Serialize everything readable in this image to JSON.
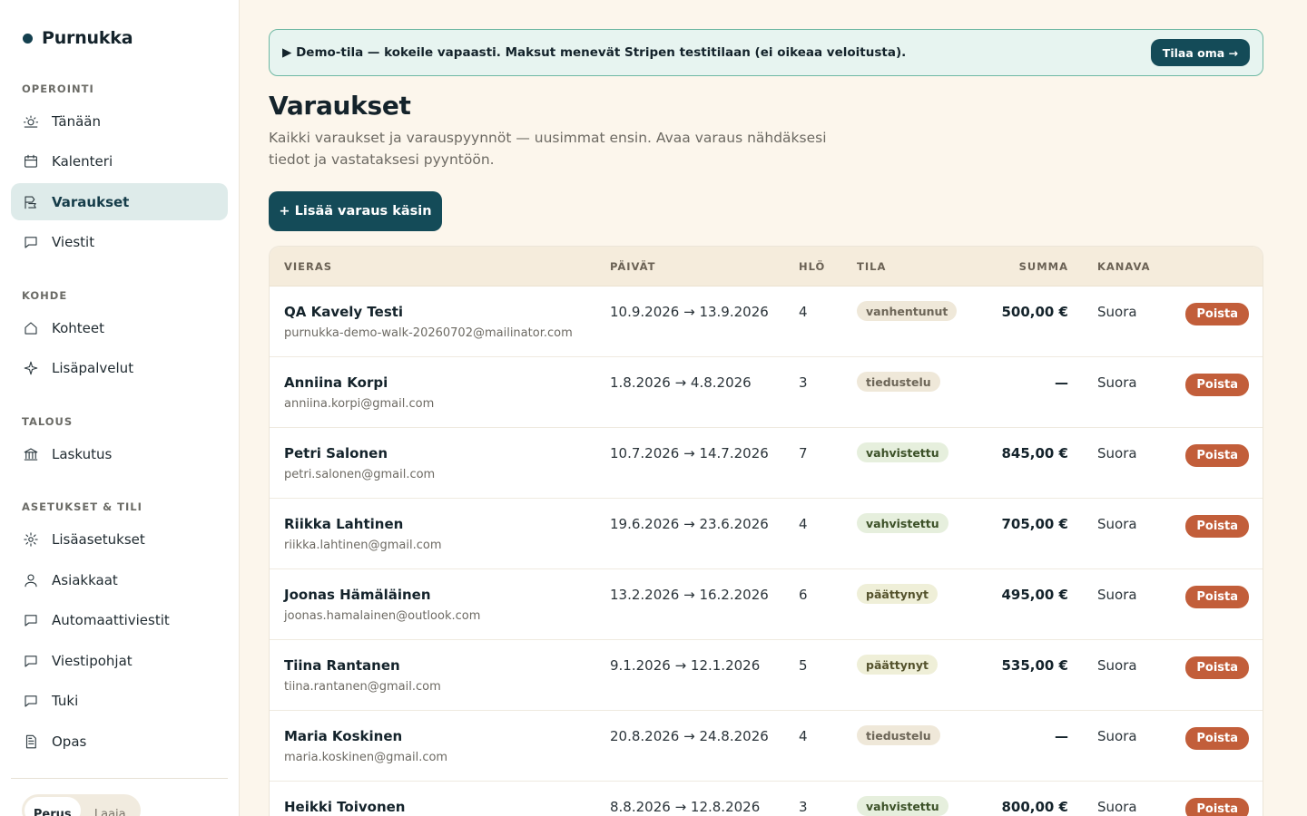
{
  "brand": {
    "name": "Purnukka"
  },
  "sidebar": {
    "sections": [
      {
        "label": "OPEROINTI",
        "items": [
          {
            "label": "Tänään",
            "icon": "sun-icon"
          },
          {
            "label": "Kalenteri",
            "icon": "calendar-icon"
          },
          {
            "label": "Varaukset",
            "icon": "bookings-icon",
            "active": true
          },
          {
            "label": "Viestit",
            "icon": "chat-icon"
          }
        ]
      },
      {
        "label": "KOHDE",
        "items": [
          {
            "label": "Kohteet",
            "icon": "home-icon"
          },
          {
            "label": "Lisäpalvelut",
            "icon": "sparkle-icon"
          }
        ]
      },
      {
        "label": "TALOUS",
        "items": [
          {
            "label": "Laskutus",
            "icon": "bank-icon"
          }
        ]
      },
      {
        "label": "ASETUKSET & TILI",
        "items": [
          {
            "label": "Lisäasetukset",
            "icon": "gear-icon"
          },
          {
            "label": "Asiakkaat",
            "icon": "user-icon"
          },
          {
            "label": "Automaattiviestit",
            "icon": "chat-icon"
          },
          {
            "label": "Viestipohjat",
            "icon": "chat-icon"
          },
          {
            "label": "Tuki",
            "icon": "chat-icon"
          },
          {
            "label": "Opas",
            "icon": "document-icon"
          }
        ]
      }
    ],
    "mode_toggle": {
      "options": [
        "Perus",
        "Laaja"
      ],
      "selected": "Perus"
    }
  },
  "banner": {
    "text": "▶ Demo-tila — kokeile vapaasti. Maksut menevät Stripen testitilaan (ei oikeaa veloitusta).",
    "button": "Tilaa oma →"
  },
  "page": {
    "title": "Varaukset",
    "subtitle": "Kaikki varaukset ja varauspyynnöt — uusimmat ensin. Avaa varaus nähdäksesi tiedot ja vastataksesi pyyntöön.",
    "add_button": "+ Lisää varaus käsin"
  },
  "table": {
    "headers": {
      "guest": "VIERAS",
      "dates": "PÄIVÄT",
      "people": "HLÖ",
      "status": "TILA",
      "sum": "SUMMA",
      "channel": "KANAVA"
    },
    "delete_label": "Poista",
    "rows": [
      {
        "name": "QA Kavely Testi",
        "email": "purnukka-demo-walk-20260702@mailinator.com",
        "dates": "10.9.2026 → 13.9.2026",
        "people": "4",
        "status": "vanhentunut",
        "status_class": "vanhentunut",
        "sum": "500,00 €",
        "channel": "Suora"
      },
      {
        "name": "Anniina Korpi",
        "email": "anniina.korpi@gmail.com",
        "dates": "1.8.2026 → 4.8.2026",
        "people": "3",
        "status": "tiedustelu",
        "status_class": "tiedustelu",
        "sum": "—",
        "channel": "Suora"
      },
      {
        "name": "Petri Salonen",
        "email": "petri.salonen@gmail.com",
        "dates": "10.7.2026 → 14.7.2026",
        "people": "7",
        "status": "vahvistettu",
        "status_class": "vahvistettu",
        "sum": "845,00 €",
        "channel": "Suora"
      },
      {
        "name": "Riikka Lahtinen",
        "email": "riikka.lahtinen@gmail.com",
        "dates": "19.6.2026 → 23.6.2026",
        "people": "4",
        "status": "vahvistettu",
        "status_class": "vahvistettu",
        "sum": "705,00 €",
        "channel": "Suora"
      },
      {
        "name": "Joonas Hämäläinen",
        "email": "joonas.hamalainen@outlook.com",
        "dates": "13.2.2026 → 16.2.2026",
        "people": "6",
        "status": "päättynyt",
        "status_class": "paattynyt",
        "sum": "495,00 €",
        "channel": "Suora"
      },
      {
        "name": "Tiina Rantanen",
        "email": "tiina.rantanen@gmail.com",
        "dates": "9.1.2026 → 12.1.2026",
        "people": "5",
        "status": "päättynyt",
        "status_class": "paattynyt",
        "sum": "535,00 €",
        "channel": "Suora"
      },
      {
        "name": "Maria Koskinen",
        "email": "maria.koskinen@gmail.com",
        "dates": "20.8.2026 → 24.8.2026",
        "people": "4",
        "status": "tiedustelu",
        "status_class": "tiedustelu",
        "sum": "—",
        "channel": "Suora"
      },
      {
        "name": "Heikki Toivonen",
        "email": "",
        "dates": "8.8.2026 → 12.8.2026",
        "people": "3",
        "status": "vahvistettu",
        "status_class": "vahvistettu",
        "sum": "800,00 €",
        "channel": "Suora"
      }
    ]
  },
  "colors": {
    "primary": "#144b58",
    "background": "#fcf6ec",
    "delete": "#c25e3a",
    "banner_border": "#6fb8a3"
  }
}
